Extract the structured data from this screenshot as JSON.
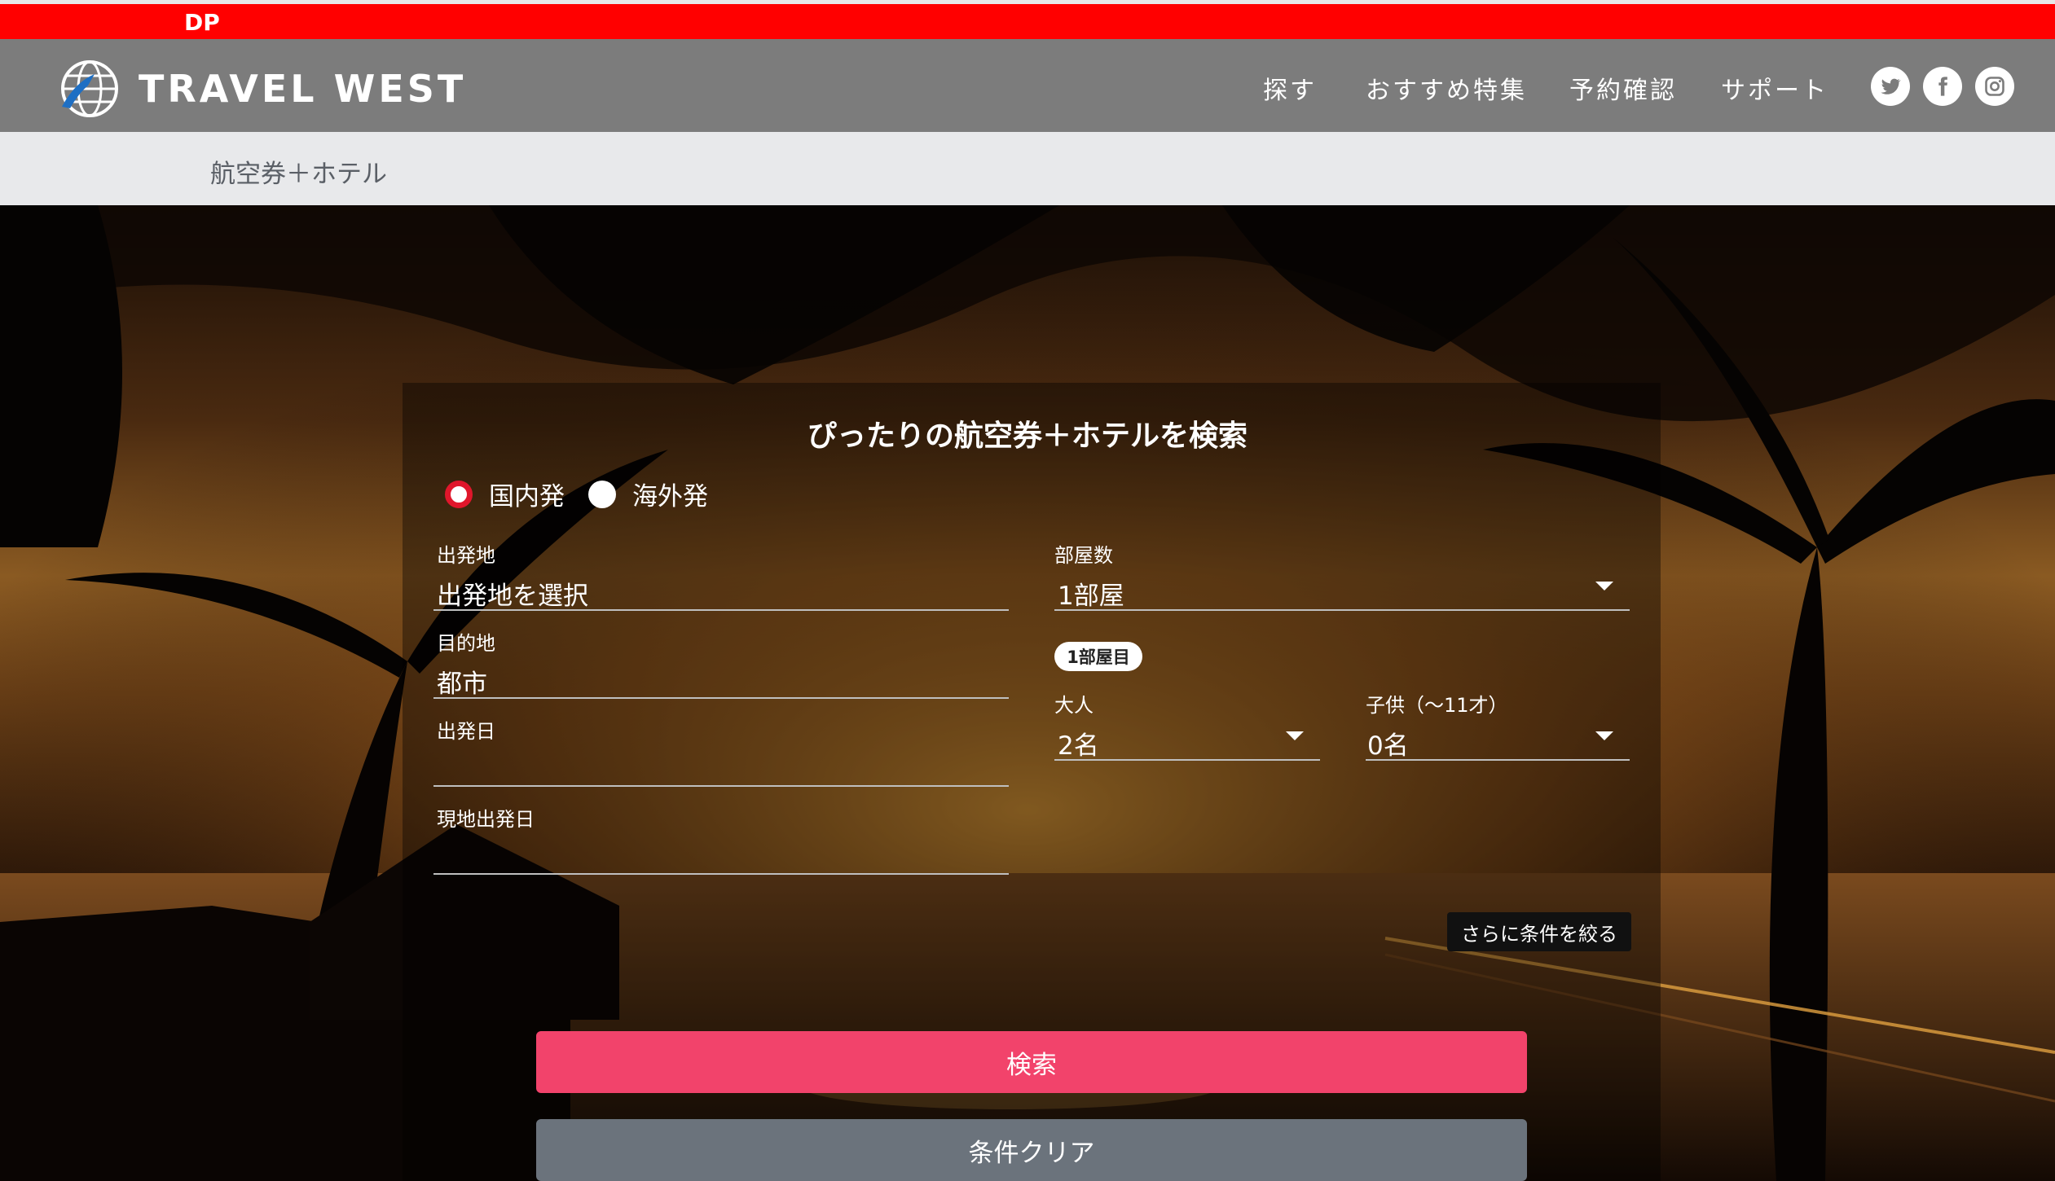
{
  "top_bar": {
    "label": "DP",
    "color": "#ff0000"
  },
  "header": {
    "logo_text": "TRAVEL WEST",
    "nav": [
      "探す",
      "おすすめ特集",
      "予約確認",
      "サポート"
    ],
    "social": [
      "twitter-icon",
      "facebook-icon",
      "instagram-icon"
    ]
  },
  "breadcrumb": {
    "current": "航空券＋ホテル"
  },
  "search": {
    "title": "ぴったりの航空券＋ホテルを検索",
    "origin_type": {
      "domestic": "国内発",
      "overseas": "海外発",
      "selected": "国内発"
    },
    "departure": {
      "label": "出発地",
      "value": "出発地を選択"
    },
    "destination": {
      "label": "目的地",
      "value": "都市"
    },
    "departure_date": {
      "label": "出発日",
      "value": ""
    },
    "local_departure_date": {
      "label": "現地出発日",
      "value": ""
    },
    "rooms": {
      "label": "部屋数",
      "value": "1部屋"
    },
    "room_badge": "1部屋目",
    "adults": {
      "label": "大人",
      "value": "2名"
    },
    "children": {
      "label": "子供（〜11才）",
      "value": "0名"
    },
    "refine_label": "さらに条件を絞る",
    "search_button": "検索",
    "clear_button": "条件クリア",
    "accent_color": "#f2436b"
  }
}
